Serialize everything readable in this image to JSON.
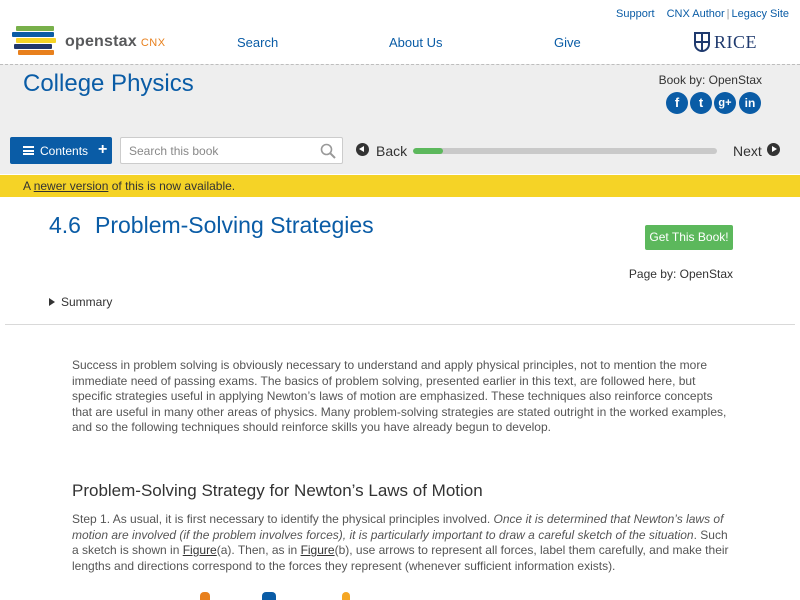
{
  "utility_links": {
    "support": "Support",
    "cnx_author": "CNX Author",
    "legacy_site": "Legacy Site",
    "separator": "|"
  },
  "logo": {
    "brand": "openstax",
    "suffix": "CNX"
  },
  "nav": {
    "search": "Search",
    "about_us": "About Us",
    "give": "Give",
    "rice": "RICE"
  },
  "book": {
    "title": "College Physics",
    "book_by": "Book by: OpenStax",
    "social": [
      "f",
      "t",
      "g+",
      "in"
    ]
  },
  "toolbar": {
    "contents_label": "Contents",
    "search_placeholder": "Search this book",
    "back_label": "Back",
    "next_label": "Next",
    "progress_fraction": 0.1
  },
  "notice": {
    "prefix": "A",
    "link": "newer version",
    "suffix": "of this is now available."
  },
  "page": {
    "section_number": "4.6",
    "section_title": "Problem-Solving Strategies",
    "get_book_label": "Get This Book!",
    "page_by": "Page by: OpenStax",
    "summary_label": "Summary"
  },
  "content": {
    "intro": "Success in problem solving is obviously necessary to understand and apply physical principles, not to mention the more immediate need of passing exams. The basics of problem solving, presented earlier in this text, are followed here, but specific strategies useful in applying Newton’s laws of motion are emphasized. These techniques also reinforce concepts that are useful in many other areas of physics. Many problem-solving strategies are stated outright in the worked examples, and so the following techniques should reinforce skills you have already begun to develop.",
    "heading": "Problem-Solving Strategy for Newton’s Laws of Motion",
    "step1_a": "Step 1. As usual, it is first necessary to identify the physical principles involved. ",
    "step1_em": "Once it is determined that Newton’s laws of motion are involved (if the problem involves forces), it is particularly important to draw a careful sketch of the situation",
    "step1_b": ". Such a sketch is shown in ",
    "figure_link": "Figure",
    "step1_c": "(a). Then, as in ",
    "step1_d": "(b), use arrows to represent all forces, label them carefully, and make their lengths and directions correspond to the forces they represent (whenever sufficient information exists)."
  },
  "colors": {
    "brand_blue": "#0a5ca6",
    "notice_yellow": "#f5d326",
    "green": "#5cb85c",
    "band_gray": "#eeeeee"
  }
}
